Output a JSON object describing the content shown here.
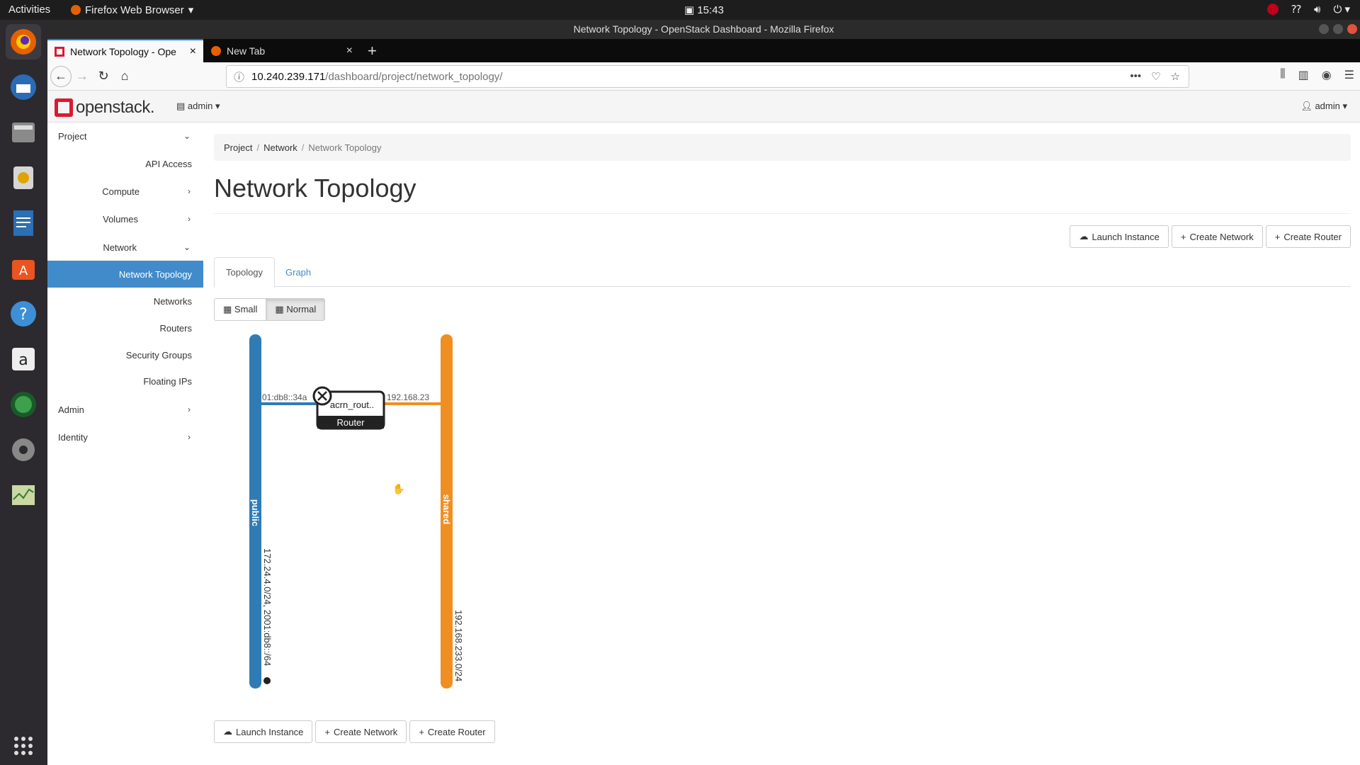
{
  "system": {
    "activities": "Activities",
    "app_menu": "Firefox Web Browser",
    "clock": "15:43"
  },
  "window": {
    "title": "Network Topology - OpenStack Dashboard - Mozilla Firefox"
  },
  "browser": {
    "tabs": [
      {
        "label": "Network Topology - Ope",
        "active": true
      },
      {
        "label": "New Tab",
        "active": false
      }
    ],
    "url_host": "10.240.239.171",
    "url_path": "/dashboard/project/network_topology/"
  },
  "os": {
    "brand": "openstack.",
    "project_selector": "admin",
    "user_menu": "admin"
  },
  "sidebar": {
    "project": "Project",
    "api_access": "API Access",
    "compute": "Compute",
    "volumes": "Volumes",
    "network": "Network",
    "network_topology": "Network Topology",
    "networks": "Networks",
    "routers": "Routers",
    "security_groups": "Security Groups",
    "floating_ips": "Floating IPs",
    "admin": "Admin",
    "identity": "Identity"
  },
  "breadcrumb": {
    "project": "Project",
    "network": "Network",
    "current": "Network Topology"
  },
  "page": {
    "title": "Network Topology",
    "launch_instance": "Launch Instance",
    "create_network": "Create Network",
    "create_router": "Create Router",
    "tab_topology": "Topology",
    "tab_graph": "Graph",
    "toggle_small": "Small",
    "toggle_normal": "Normal"
  },
  "topology": {
    "public_network": {
      "name": "public",
      "cidr": "172.24.4.0/24, 2001:db8::/64",
      "color": "#2f7cb5"
    },
    "shared_network": {
      "name": "shared",
      "cidr": "192.168.233.0/24",
      "color": "#ef8f22"
    },
    "router": {
      "name": "acrn_rout..",
      "type": "Router"
    },
    "left_port": "01:db8::34a",
    "right_port": "192.168.23"
  },
  "colors": {
    "os_red": "#da1a32",
    "active_blue": "#428bca"
  }
}
